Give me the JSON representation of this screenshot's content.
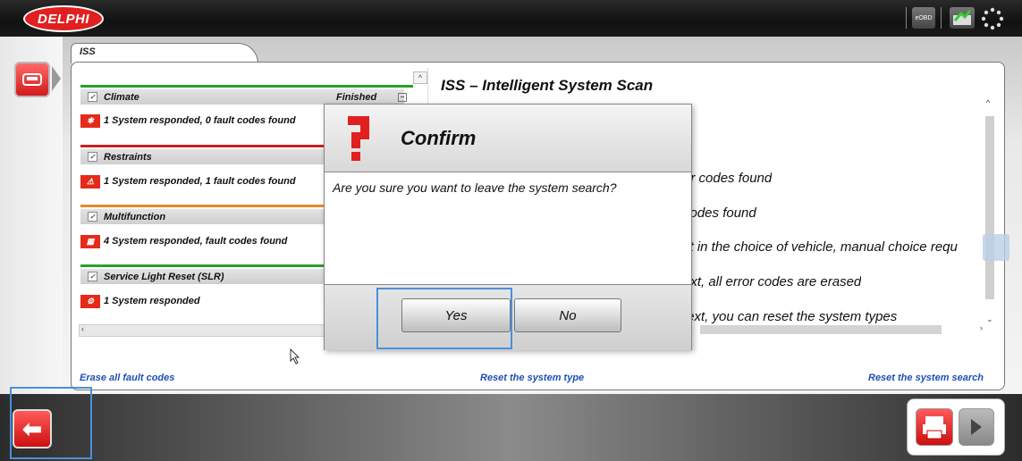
{
  "app": {
    "logo_text": "DELPHI",
    "toolbar_eobd_label": "eOBD"
  },
  "tab": {
    "label": "ISS"
  },
  "groups": [
    {
      "name": "Climate",
      "status": "Finished",
      "result": "1 System responded, 0 fault codes found",
      "color": "#2aa02a"
    },
    {
      "name": "Restraints",
      "status": "",
      "result": "1 System responded, 1 fault codes found",
      "color": "#c82020"
    },
    {
      "name": "Multifunction",
      "status": "",
      "result": "4 System responded, fault codes found",
      "color": "#e8892a"
    },
    {
      "name": "Service Light Reset (SLR)",
      "status": "",
      "result": "1 System responded",
      "color": "#2aa02a"
    }
  ],
  "help": {
    "title": "ISS – Intelligent System Scan",
    "lines": [
      "or codes found",
      "codes found",
      "ct in the choice of vehicle, manual choice requ",
      "ext, all error codes are erased",
      " text, you can reset the system types"
    ]
  },
  "footer_links": {
    "erase": "Erase all fault codes",
    "reset_type": "Reset the system type",
    "reset_search": "Reset the system search"
  },
  "dialog": {
    "title": "Confirm",
    "message": "Are you sure you want to leave the system search?",
    "yes_label": "Yes",
    "no_label": "No"
  },
  "colors": {
    "accent_red": "#e02020",
    "link_blue": "#1f4fb5",
    "highlight_blue": "#4a90d9"
  },
  "icons": [
    "delphi-logo",
    "eobd-icon",
    "update-icon",
    "loading-icon",
    "vehicle-icon",
    "back-arrow-icon",
    "print-icon",
    "next-arrow-icon",
    "question-icon"
  ]
}
